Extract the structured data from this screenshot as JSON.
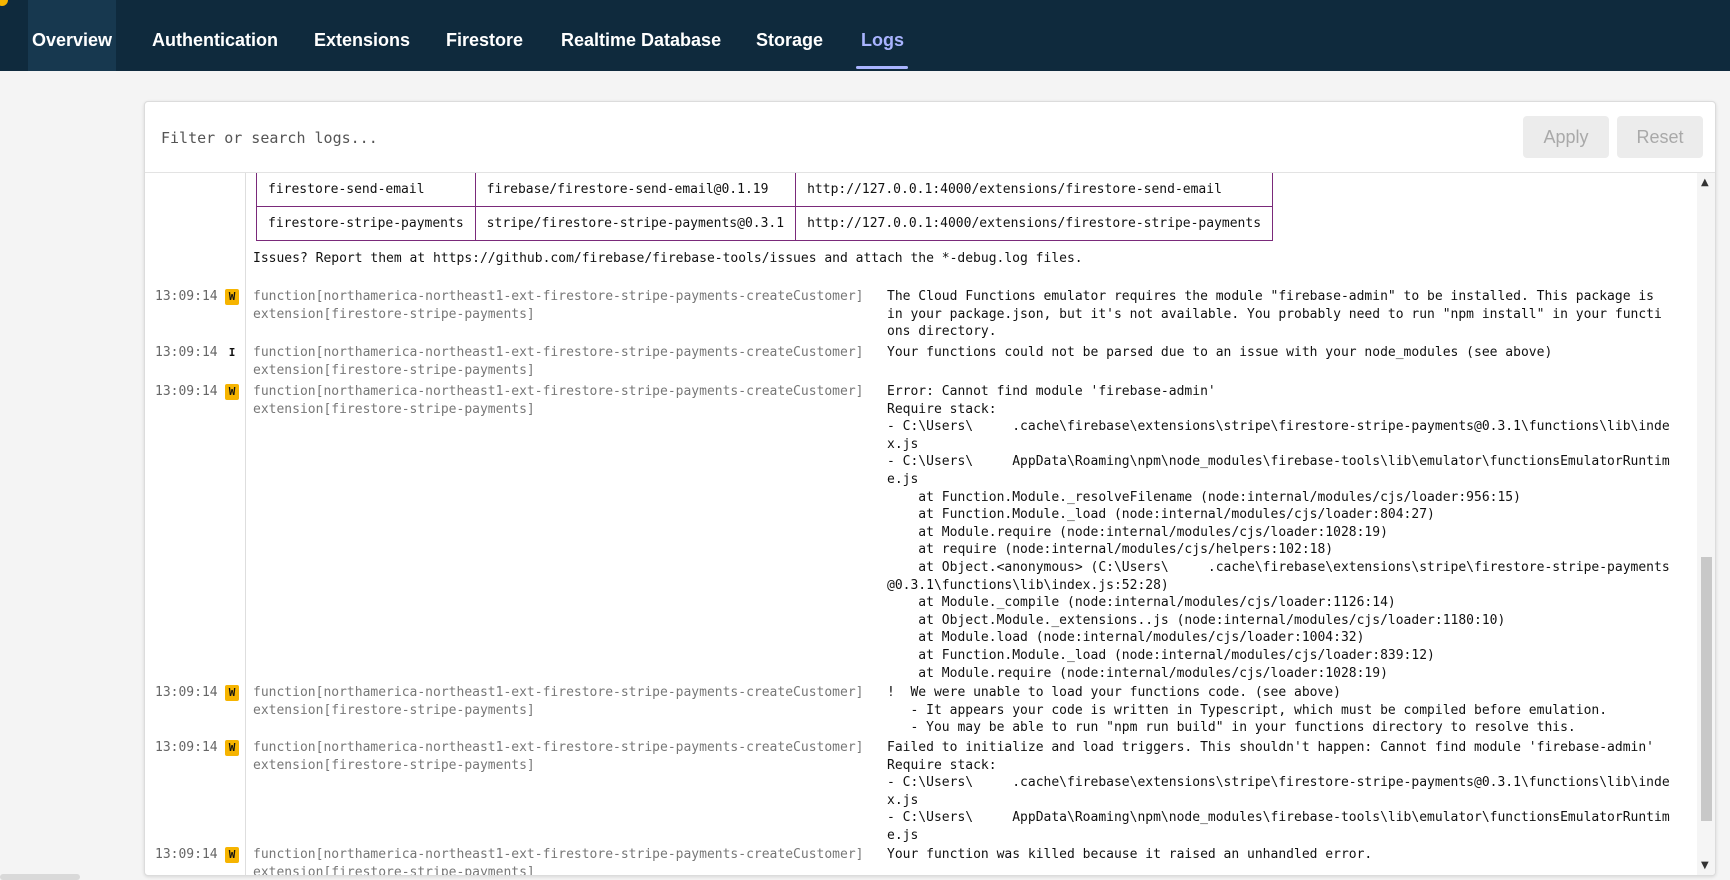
{
  "nav": {
    "tabs": [
      {
        "label": "Overview"
      },
      {
        "label": "Authentication"
      },
      {
        "label": "Extensions"
      },
      {
        "label": "Firestore"
      },
      {
        "label": "Realtime Database"
      },
      {
        "label": "Storage"
      },
      {
        "label": "Logs"
      }
    ],
    "active": "Logs"
  },
  "search": {
    "placeholder": "Filter or search logs...",
    "apply_label": "Apply",
    "reset_label": "Reset"
  },
  "extensions_table": {
    "rows": [
      {
        "id": "firestore-send-email",
        "ref": "firebase/firestore-send-email@0.1.19",
        "url": "http://127.0.0.1:4000/extensions/firestore-send-email"
      },
      {
        "id": "firestore-stripe-payments",
        "ref": "stripe/firestore-stripe-payments@0.3.1",
        "url": "http://127.0.0.1:4000/extensions/firestore-stripe-payments"
      }
    ]
  },
  "issues_text": "Issues? Report them at https://github.com/firebase/firebase-tools/issues and attach the *-debug.log files.",
  "entries": [
    {
      "time": "13:09:14",
      "level": "W",
      "source": "function[northamerica-northeast1-ext-firestore-stripe-payments-createCustomer]\nextension[firestore-stripe-payments]",
      "message": "The Cloud Functions emulator requires the module \"firebase-admin\" to be installed. This package is\nin your package.json, but it's not available. You probably need to run \"npm install\" in your functi\nons directory."
    },
    {
      "time": "13:09:14",
      "level": "I",
      "source": "function[northamerica-northeast1-ext-firestore-stripe-payments-createCustomer]\nextension[firestore-stripe-payments]",
      "message": "Your functions could not be parsed due to an issue with your node_modules (see above)"
    },
    {
      "time": "13:09:14",
      "level": "W",
      "source": "function[northamerica-northeast1-ext-firestore-stripe-payments-createCustomer]\nextension[firestore-stripe-payments]",
      "message": "Error: Cannot find module 'firebase-admin'\nRequire stack:\n- C:\\Users\\     .cache\\firebase\\extensions\\stripe\\firestore-stripe-payments@0.3.1\\functions\\lib\\inde\nx.js\n- C:\\Users\\     AppData\\Roaming\\npm\\node_modules\\firebase-tools\\lib\\emulator\\functionsEmulatorRuntim\ne.js\n    at Function.Module._resolveFilename (node:internal/modules/cjs/loader:956:15)\n    at Function.Module._load (node:internal/modules/cjs/loader:804:27)\n    at Module.require (node:internal/modules/cjs/loader:1028:19)\n    at require (node:internal/modules/cjs/helpers:102:18)\n    at Object.<anonymous> (C:\\Users\\     .cache\\firebase\\extensions\\stripe\\firestore-stripe-payments\n@0.3.1\\functions\\lib\\index.js:52:28)\n    at Module._compile (node:internal/modules/cjs/loader:1126:14)\n    at Object.Module._extensions..js (node:internal/modules/cjs/loader:1180:10)\n    at Module.load (node:internal/modules/cjs/loader:1004:32)\n    at Function.Module._load (node:internal/modules/cjs/loader:839:12)\n    at Module.require (node:internal/modules/cjs/loader:1028:19)"
    },
    {
      "time": "13:09:14",
      "level": "W",
      "source": "function[northamerica-northeast1-ext-firestore-stripe-payments-createCustomer]\nextension[firestore-stripe-payments]",
      "message": "!  We were unable to load your functions code. (see above)\n   - It appears your code is written in Typescript, which must be compiled before emulation.\n   - You may be able to run \"npm run build\" in your functions directory to resolve this."
    },
    {
      "time": "13:09:14",
      "level": "W",
      "source": "function[northamerica-northeast1-ext-firestore-stripe-payments-createCustomer]\nextension[firestore-stripe-payments]",
      "message": "Failed to initialize and load triggers. This shouldn't happen: Cannot find module 'firebase-admin'\nRequire stack:\n- C:\\Users\\     .cache\\firebase\\extensions\\stripe\\firestore-stripe-payments@0.3.1\\functions\\lib\\inde\nx.js\n- C:\\Users\\     AppData\\Roaming\\npm\\node_modules\\firebase-tools\\lib\\emulator\\functionsEmulatorRuntim\ne.js"
    },
    {
      "time": "13:09:14",
      "level": "W",
      "source": "function[northamerica-northeast1-ext-firestore-stripe-payments-createCustomer]\nextension[firestore-stripe-payments]",
      "message": "Your function was killed because it raised an unhandled error."
    }
  ],
  "colors": {
    "nav_bg": "#0f2a3d",
    "active_tab": "#a9b4ff",
    "warn_badge": "#f6b400",
    "table_border": "#7a2a7a"
  }
}
